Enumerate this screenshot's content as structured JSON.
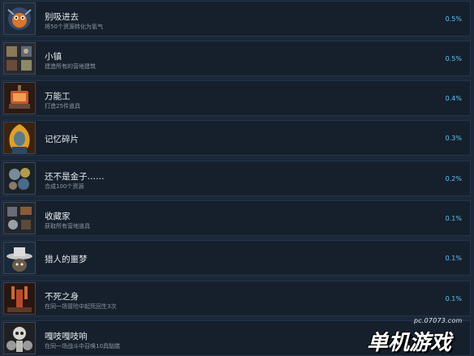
{
  "achievements": [
    {
      "title": "别吸进去",
      "desc": "将50个资源转化为氢气",
      "percent": "0.5%",
      "icon": "vortex-creature-icon",
      "accent": "#d9772a"
    },
    {
      "title": "小镇",
      "desc": "建造所有的营地建筑",
      "percent": "0.5%",
      "icon": "town-buildings-icon",
      "accent": "#8a7a5a"
    },
    {
      "title": "万能工",
      "desc": "打造25件道具",
      "percent": "0.4%",
      "icon": "workshop-forge-icon",
      "accent": "#c4582a"
    },
    {
      "title": "记忆碎片",
      "desc": "",
      "percent": "0.3%",
      "icon": "flame-portrait-icon",
      "accent": "#e0a02a"
    },
    {
      "title": "还不是金子……",
      "desc": "合成100个资源",
      "percent": "0.2%",
      "icon": "alchemy-resources-icon",
      "accent": "#b59a4a"
    },
    {
      "title": "收藏家",
      "desc": "获取所有营地道具",
      "percent": "0.1%",
      "icon": "item-collection-icon",
      "accent": "#6a6a7a"
    },
    {
      "title": "猎人的噩梦",
      "desc": "",
      "percent": "0.1%",
      "icon": "hunter-hat-icon",
      "accent": "#c8c8c8"
    },
    {
      "title": "不死之身",
      "desc": "在同一场冒险中起死回生3次",
      "percent": "0.1%",
      "icon": "undying-hand-icon",
      "accent": "#b84a2a"
    },
    {
      "title": "嘎吱嘎吱响",
      "desc": "在同一场战斗中召唤10具骷髅",
      "percent": "",
      "icon": "skeleton-pile-icon",
      "accent": "#9a9a9a"
    }
  ],
  "watermark": {
    "url": "pc.07073.com",
    "brand": "单机游戏"
  },
  "colors": {
    "background": "#1b2838",
    "row": "#16202d",
    "percent": "#67c1f5"
  }
}
